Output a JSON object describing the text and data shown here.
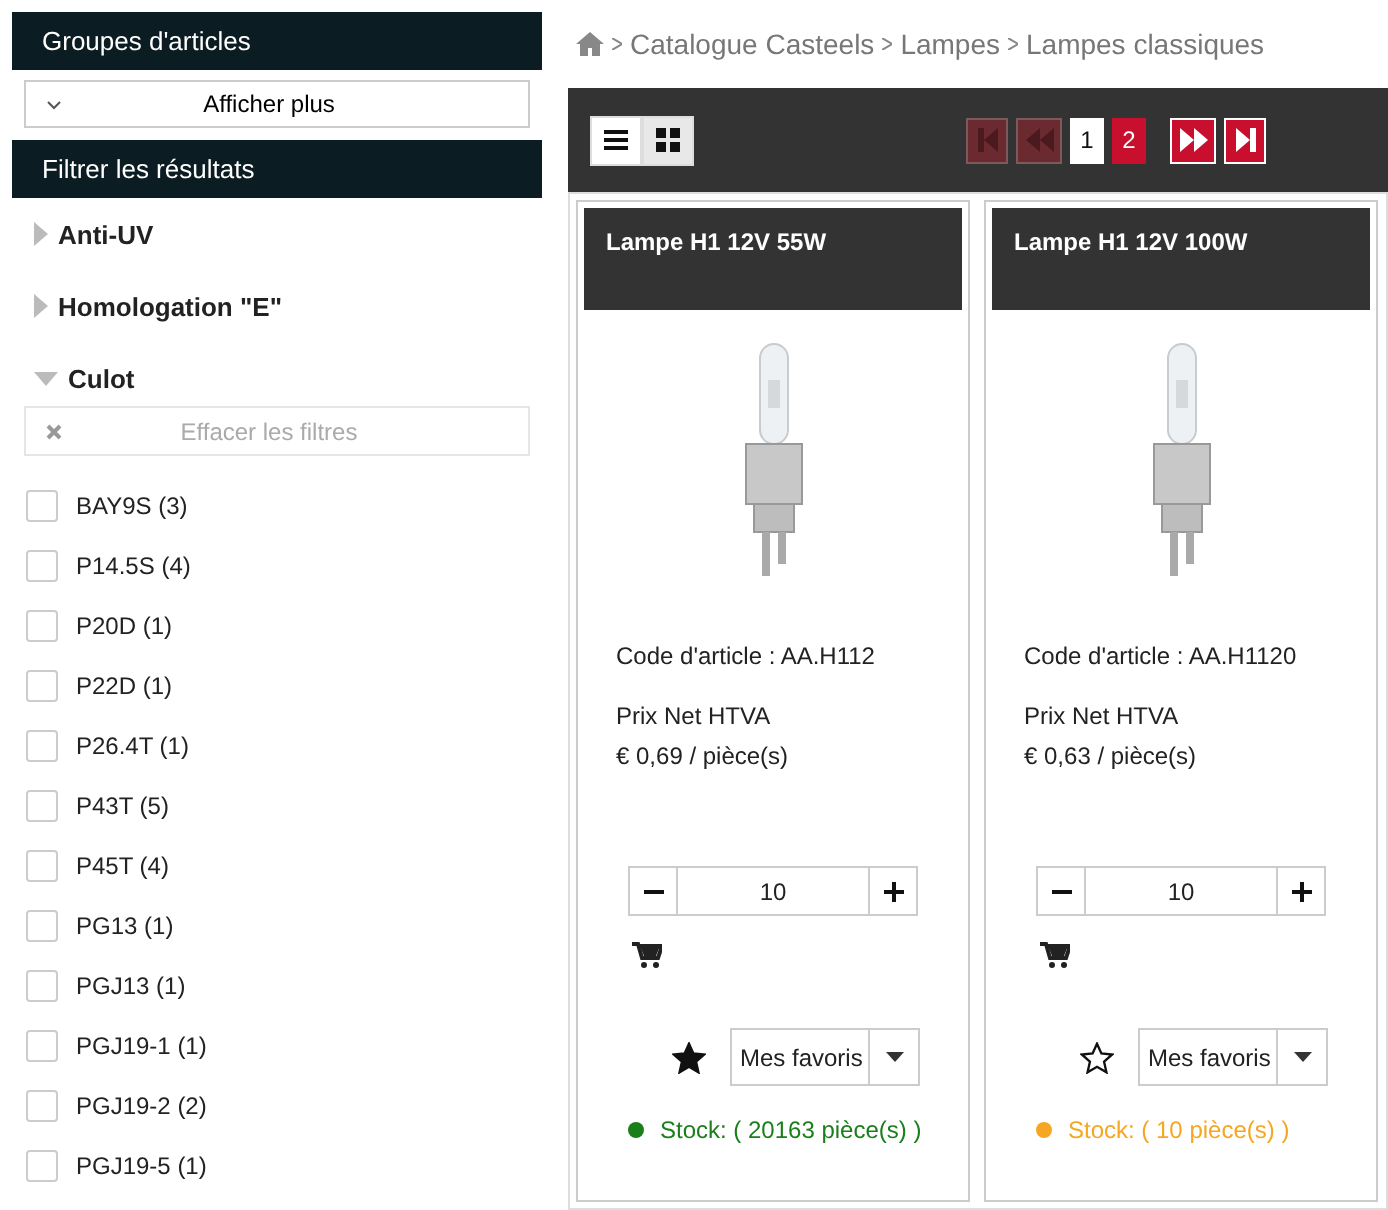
{
  "sidebar": {
    "groups_header": "Groupes d'articles",
    "show_more_button": "Afficher plus",
    "filter_header": "Filtrer les résultats",
    "filters": [
      {
        "label": "Anti-UV",
        "expanded": false
      },
      {
        "label": "Homologation \"E\"",
        "expanded": false
      },
      {
        "label": "Culot",
        "expanded": true
      }
    ],
    "clear_filters_button": {
      "label": "Effacer les filtres",
      "disabled": true
    },
    "options": [
      {
        "label": "BAY9S (3)",
        "checked": false
      },
      {
        "label": "P14.5S (4)",
        "checked": false
      },
      {
        "label": "P20D (1)",
        "checked": false
      },
      {
        "label": "P22D (1)",
        "checked": false
      },
      {
        "label": "P26.4T (1)",
        "checked": false
      },
      {
        "label": "P43T (5)",
        "checked": false
      },
      {
        "label": "P45T (4)",
        "checked": false
      },
      {
        "label": "PG13 (1)",
        "checked": false
      },
      {
        "label": "PGJ13 (1)",
        "checked": false
      },
      {
        "label": "PGJ19-1 (1)",
        "checked": false
      },
      {
        "label": "PGJ19-2 (2)",
        "checked": false
      },
      {
        "label": "PGJ19-5 (1)",
        "checked": false
      }
    ]
  },
  "breadcrumb": [
    "Catalogue Casteels",
    "Lampes",
    "Lampes classiques"
  ],
  "view_toggle": [
    {
      "kind": "list",
      "selected": true
    },
    {
      "kind": "grid",
      "selected": false
    }
  ],
  "pagination": [
    {
      "kind": "first",
      "disabled": true
    },
    {
      "kind": "prev",
      "disabled": true
    },
    {
      "kind": "page",
      "label": "1",
      "selected": true
    },
    {
      "kind": "page",
      "label": "2",
      "selected": false
    },
    {
      "kind": "next",
      "disabled": false
    },
    {
      "kind": "last",
      "disabled": false
    }
  ],
  "products": [
    {
      "title": "Lampe H1 12V 55W",
      "code": "Code d'article : AA.H112",
      "price_label": "Prix Net HTVA",
      "price": "€ 0,69 / pièce(s)",
      "quantity": "10",
      "favorite": true,
      "favorites_select": "Mes favoris",
      "stock": "Stock: ( 20163 pièce(s) )",
      "color": "#1a7f1a"
    },
    {
      "title": "Lampe H1 12V 100W",
      "code": "Code d'article : AA.H1120",
      "price_label": "Prix Net HTVA",
      "price": "€ 0,63 / pièce(s)",
      "quantity": "10",
      "favorite": false,
      "favorites_select": "Mes favoris",
      "stock": "Stock: ( 10 pièce(s) )",
      "color": "#f5a623"
    }
  ]
}
